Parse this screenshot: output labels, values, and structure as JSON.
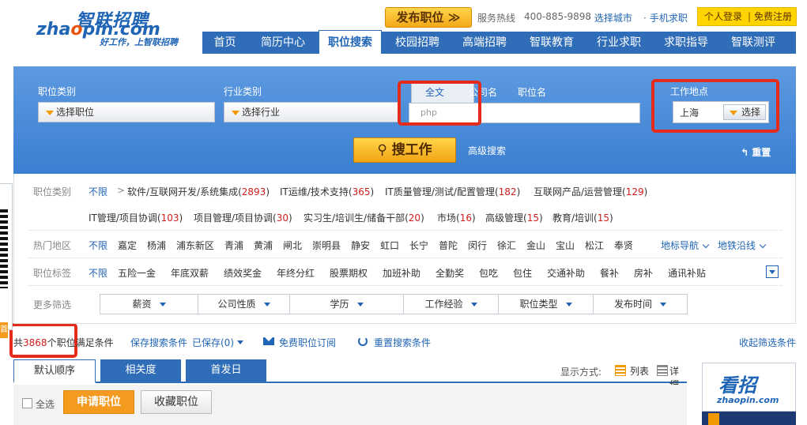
{
  "header": {
    "logo_cn": "智联招聘",
    "logo_en_pre": "zha",
    "logo_en_o": "o",
    "logo_en_post": "pin.com",
    "logo_slogan": "好工作，上智联招聘",
    "post_job": "发布职位 ≫",
    "hotline_label": "服务热线",
    "hotline_number": "400-885-9898",
    "choose_city": "选择城市",
    "mobile_job": "手机求职",
    "personal_login": "个人登录",
    "free_register": "免费注册",
    "login_sep": "|"
  },
  "nav": {
    "items": [
      "首页",
      "简历中心",
      "职位搜索",
      "校园招聘",
      "高端招聘",
      "智联教育",
      "行业求职",
      "求职指导",
      "智联测评"
    ],
    "active_index": 2
  },
  "search": {
    "job_category_label": "职位类别",
    "job_category_select": "选择职位",
    "industry_label": "行业类别",
    "industry_select": "选择行业",
    "tabs": [
      "全文",
      "公司名",
      "职位名"
    ],
    "keyword_value": "php",
    "location_label": "工作地点",
    "location_value": "上海",
    "location_select": "选择",
    "search_button": "搜工作",
    "advanced_search": "高级搜索",
    "reset": "重置"
  },
  "filters": {
    "category_label": "职位类别",
    "unlimited": "不限",
    "category_items": [
      {
        "name": "软件/互联网开发/系统集成",
        "count": "2893"
      },
      {
        "name": "IT运维/技术支持",
        "count": "365"
      },
      {
        "name": "IT质量管理/测试/配置管理",
        "count": "182"
      },
      {
        "name": "互联网产品/运营管理",
        "count": "129"
      },
      {
        "name": "IT管理/项目协调",
        "count": "103"
      },
      {
        "name": "项目管理/项目协调",
        "count": "30"
      },
      {
        "name": "实习生/培训生/储备干部",
        "count": "20"
      },
      {
        "name": "市场",
        "count": "16"
      },
      {
        "name": "高级管理",
        "count": "15"
      },
      {
        "name": "教育/培训",
        "count": "15"
      }
    ],
    "hot_area_label": "热门地区",
    "areas": [
      "嘉定",
      "杨浦",
      "浦东新区",
      "青浦",
      "黄浦",
      "闸北",
      "崇明县",
      "静安",
      "虹口",
      "长宁",
      "普陀",
      "闵行",
      "徐汇",
      "金山",
      "宝山",
      "松江",
      "奉贤"
    ],
    "area_nav": "地标导航",
    "metro_nav": "地铁沿线",
    "tag_label": "职位标签",
    "tags": [
      "五险一金",
      "年底双薪",
      "绩效奖金",
      "年终分红",
      "股票期权",
      "加班补助",
      "全勤奖",
      "包吃",
      "包住",
      "交通补助",
      "餐补",
      "房补",
      "通讯补贴"
    ],
    "more_label": "更多筛选",
    "more_items": [
      "薪资",
      "公司性质",
      "学历",
      "工作经验",
      "职位类型",
      "发布时间"
    ]
  },
  "results": {
    "count_prefix": "共",
    "count": "3868",
    "count_suffix": "个职位满足条件",
    "save_search": "保存搜索条件",
    "saved": "已保存(0)",
    "free_subscribe": "免费职位订阅",
    "reset_search": "重置搜索条件",
    "collapse_filter": "收起筛选条件"
  },
  "sort": {
    "tabs": [
      "默认顺序",
      "相关度",
      "首发日"
    ],
    "display_label": "显示方式:",
    "list_view": "列表",
    "detail_view": "详细"
  },
  "actions": {
    "select_all": "全选",
    "apply": "申请职位",
    "favorite": "收藏职位"
  },
  "side": {
    "side_tag": "首"
  },
  "ad": {
    "brand": "看招",
    "site": "zhaopin.com"
  },
  "colors": {
    "brand_blue": "#2f6db8",
    "accent_orange": "#f39800",
    "count_red": "#d31e1e",
    "annotation_red": "#e42b1c"
  }
}
